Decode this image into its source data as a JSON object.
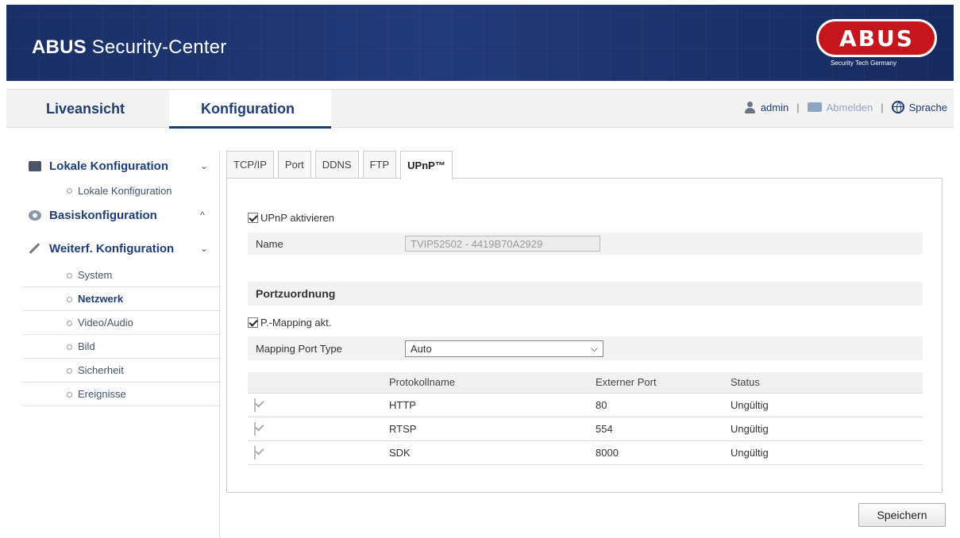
{
  "header": {
    "title_bold": "ABUS",
    "title_rest": " Security-Center",
    "logo_text": "ABUS",
    "logo_subtitle": "Security Tech Germany"
  },
  "nav": {
    "tabs": [
      {
        "label": "Liveansicht"
      },
      {
        "label": "Konfiguration",
        "active": true
      }
    ],
    "user": "admin",
    "logout": "Abmelden",
    "language": "Sprache",
    "separator": "|"
  },
  "sidebar": {
    "groups": [
      {
        "label": "Lokale Konfiguration",
        "icon": "folder-icon",
        "chevron": "⌄",
        "items": [
          "Lokale Konfiguration"
        ]
      },
      {
        "label": "Basiskonfiguration",
        "icon": "gear-icon",
        "chevron": "^",
        "items": []
      },
      {
        "label": "Weiterf. Konfiguration",
        "icon": "wrench-icon",
        "chevron": "⌄",
        "items": [
          "System",
          "Netzwerk",
          "Video/Audio",
          "Bild",
          "Sicherheit",
          "Ereignisse"
        ],
        "active_item": "Netzwerk"
      }
    ]
  },
  "tabs": [
    "TCP/IP",
    "Port",
    "DDNS",
    "FTP",
    "UPnP™"
  ],
  "active_tab": "UPnP™",
  "form": {
    "upnp_enable_label": "UPnP aktivieren",
    "upnp_enabled": true,
    "name_label": "Name",
    "name_value": "TVIP52502 - 4419B70A2929",
    "section_title": "Portzuordnung",
    "mapping_enable_label": "P.-Mapping akt.",
    "mapping_enabled": true,
    "mapping_type_label": "Mapping Port Type",
    "mapping_type_value": "Auto",
    "dropdown_arrow": "⌵"
  },
  "ports_table": {
    "headers": [
      "",
      "Protokollname",
      "Externer Port",
      "Status"
    ],
    "rows": [
      {
        "protocol": "HTTP",
        "port": "80",
        "status": "Ungültig"
      },
      {
        "protocol": "RTSP",
        "port": "554",
        "status": "Ungültig"
      },
      {
        "protocol": "SDK",
        "port": "8000",
        "status": "Ungültig"
      }
    ]
  },
  "save_label": "Speichern",
  "colors": {
    "brand_blue": "#1f3d7a",
    "banner": "#1a2f66",
    "logo_red": "#c4161c"
  }
}
